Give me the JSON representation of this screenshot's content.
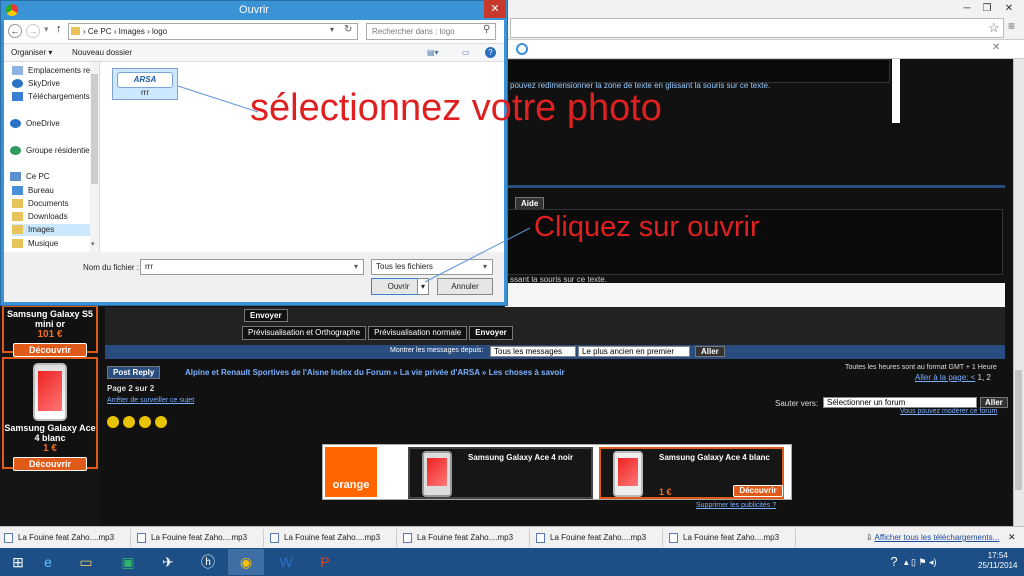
{
  "dialog": {
    "title": "Ouvrir",
    "close": "✕",
    "path": [
      "Ce PC",
      "Images",
      "logo"
    ],
    "path_sep": "›",
    "search_placeholder": "Rechercher dans : logo",
    "organize": "Organiser ▾",
    "new_folder": "Nouveau dossier",
    "nav": [
      "Emplacements re",
      "SkyDrive",
      "Téléchargements",
      "OneDrive",
      "Groupe résidentiel",
      "Ce PC",
      "Bureau",
      "Documents",
      "Downloads",
      "Images",
      "Musique"
    ],
    "selected_nav": "Images",
    "file": {
      "label": "rrr",
      "logo_text": "ARSA"
    },
    "filename_label": "Nom du fichier :",
    "filename_value": "rrr",
    "filter": "Tous les fichiers",
    "open_btn": "Ouvrir",
    "cancel_btn": "Annuler"
  },
  "annotations": {
    "select_photo": "sélectionnez votre photo",
    "click_open": "Cliquez sur ouvrir"
  },
  "forum": {
    "hint1": "pouvez redimensionner la zone de texte en glissant la souris sur ce texte.",
    "hint2": "ssant la souris sur ce texte.",
    "help_btn": "Aide",
    "send_btn": "Envoyer",
    "tabs": [
      "Prévisualisation et Orthographe",
      "Prévisualisation normale",
      "Envoyer"
    ],
    "show_messages_label": "Montrer les messages depuis:",
    "show_messages_value": "Tous les messages",
    "order_value": "Le plus ancien en premier",
    "go": "Aller",
    "post_reply": "Post Reply",
    "breadcrumb": "Alpine et Renault Sportives de l'Aisne Index du Forum » La vie privée d'ARSA » Les choses à savoir",
    "timezone": "Toutes les heures sont au format GMT + 1 Heure",
    "goto_page": "Aller à la page: <",
    "goto_pages": "1, 2",
    "page_info": "Page 2 sur 2",
    "stop_watch": "Arrêter de surveiller ce sujet",
    "jump_label": "Sauter vers:",
    "jump_value": "Sélectionner un forum",
    "can_moderate": "Vous pouvez modérer ce forum"
  },
  "sidebar_ads": [
    {
      "name": "Samsung Galaxy S5 mini or",
      "price": "101 €",
      "button": "Découvrir"
    },
    {
      "name": "Samsung Galaxy Ace 4 blanc",
      "price": "1 €",
      "button": "Découvrir"
    }
  ],
  "ad_banner": {
    "brand": "orange",
    "cards": [
      {
        "name": "Samsung Galaxy Ace 4 noir"
      },
      {
        "name": "Samsung Galaxy Ace 4 blanc",
        "price": "1 €",
        "button": "Découvrir"
      }
    ],
    "remove_ads": "Supprimer les publicités ?"
  },
  "downloads": {
    "items": [
      "La Fouine feat Zaho....mp3",
      "La Fouine feat Zaho....mp3",
      "La Fouine feat Zaho....mp3",
      "La Fouine feat Zaho....mp3",
      "La Fouine feat Zaho....mp3",
      "La Fouine feat Zaho....mp3"
    ],
    "show_all": "Afficher tous les téléchargements...",
    "close": "✕"
  },
  "taskbar": {
    "time": "17:54",
    "date": "25/11/2014"
  },
  "colors": {
    "accent_orange": "#e05a1a",
    "annotation_red": "#e02020",
    "dialog_blue": "#3b92d4"
  }
}
